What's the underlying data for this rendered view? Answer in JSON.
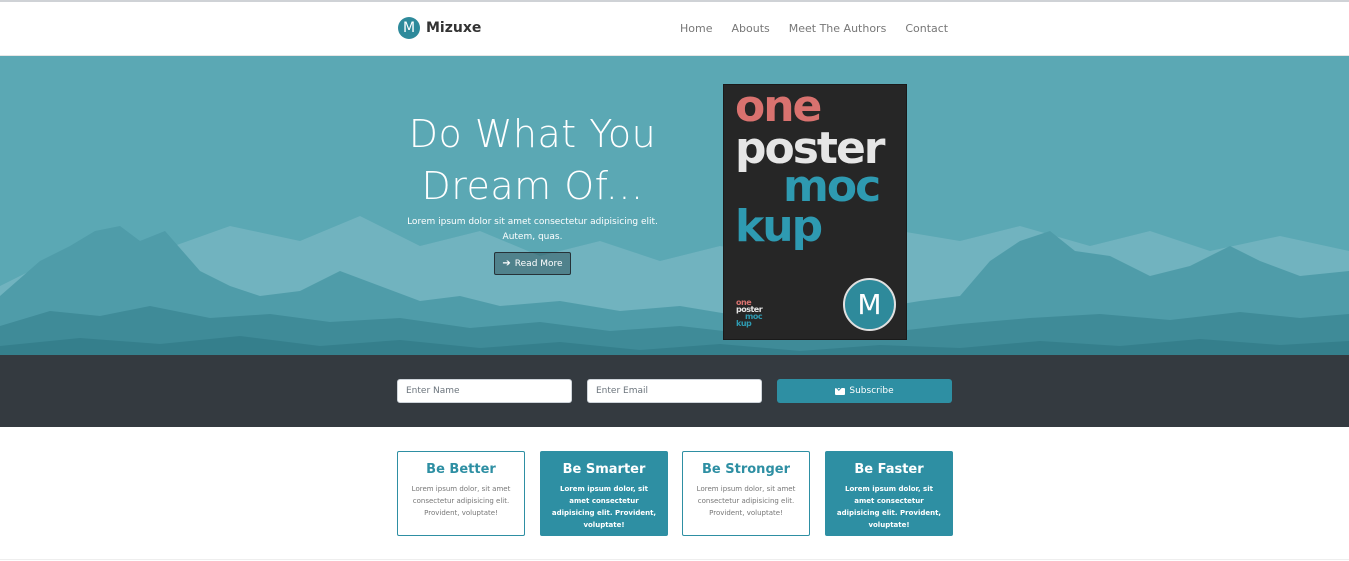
{
  "nav": {
    "brand_logo_letter": "M",
    "brand_name": "Mizuxe",
    "links": [
      "Home",
      "Abouts",
      "Meet The Authors",
      "Contact"
    ]
  },
  "hero": {
    "title_line1": "Do What You",
    "title_line2": "Dream Of...",
    "subtitle": "Lorem ipsum dolor sit amet consectetur adipisicing elit. Autem, quas.",
    "read_more_label": "Read More",
    "read_more_icon": "arrow-right-icon"
  },
  "poster": {
    "words": [
      "one",
      "poster",
      "moc",
      "kup"
    ],
    "mini_words": [
      "one",
      "poster",
      "moc",
      "kup"
    ],
    "badge_letter": "M"
  },
  "subscribe": {
    "name_placeholder": "Enter Name",
    "email_placeholder": "Enter Email",
    "button_label": "Subscribe",
    "button_icon": "envelope-icon"
  },
  "cards": [
    {
      "title": "Be Better",
      "text": "Lorem ipsum dolor, sit amet consectetur adipisicing elit. Provident, voluptate!",
      "style": "outline"
    },
    {
      "title": "Be Smarter",
      "text": "Lorem ipsum dolor, sit amet consectetur adipisicing elit. Provident, voluptate!",
      "style": "filled"
    },
    {
      "title": "Be Stronger",
      "text": "Lorem ipsum dolor, sit amet consectetur adipisicing elit. Provident, voluptate!",
      "style": "outline"
    },
    {
      "title": "Be Faster",
      "text": "Lorem ipsum dolor, sit amet consectetur adipisicing elit. Provident, voluptate!",
      "style": "filled"
    }
  ],
  "colors": {
    "primary": "#2e8fa3",
    "hero_bg": "#5aa7b3",
    "dark_bar": "#343a40",
    "poster_red": "#d9726f",
    "poster_teal": "#2e9ab1"
  }
}
